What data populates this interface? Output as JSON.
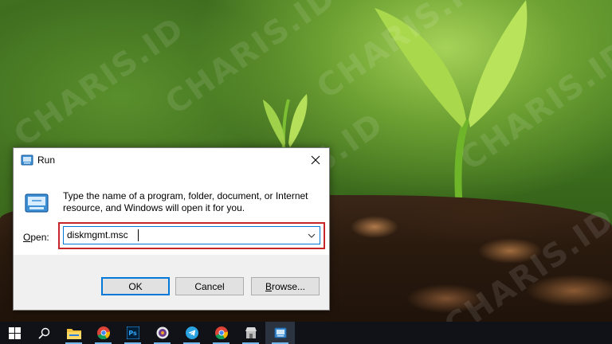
{
  "dialog": {
    "title": "Run",
    "description": "Type the name of a program, folder, document, or Internet resource, and Windows will open it for you.",
    "open_label_accel": "O",
    "open_label_rest": "pen:",
    "input_value": "diskmgmt.msc",
    "buttons": {
      "ok": "OK",
      "cancel": "Cancel",
      "browse_accel": "B",
      "browse_rest": "rowse..."
    }
  },
  "taskbar": {
    "items": [
      {
        "icon": "windows-start-icon"
      },
      {
        "icon": "search-icon"
      },
      {
        "icon": "file-explorer-icon"
      },
      {
        "icon": "chrome-icon"
      },
      {
        "icon": "photoshop-icon",
        "text": "Ps"
      },
      {
        "icon": "media-player-icon"
      },
      {
        "icon": "telegram-icon"
      },
      {
        "icon": "chrome-icon"
      },
      {
        "icon": "store-icon"
      },
      {
        "icon": "run-app-icon"
      }
    ]
  },
  "colors": {
    "highlight_box": "#c8242b",
    "focus_blue": "#0078d7",
    "taskbar": "#101218"
  },
  "watermark": "CHARIS.ID"
}
